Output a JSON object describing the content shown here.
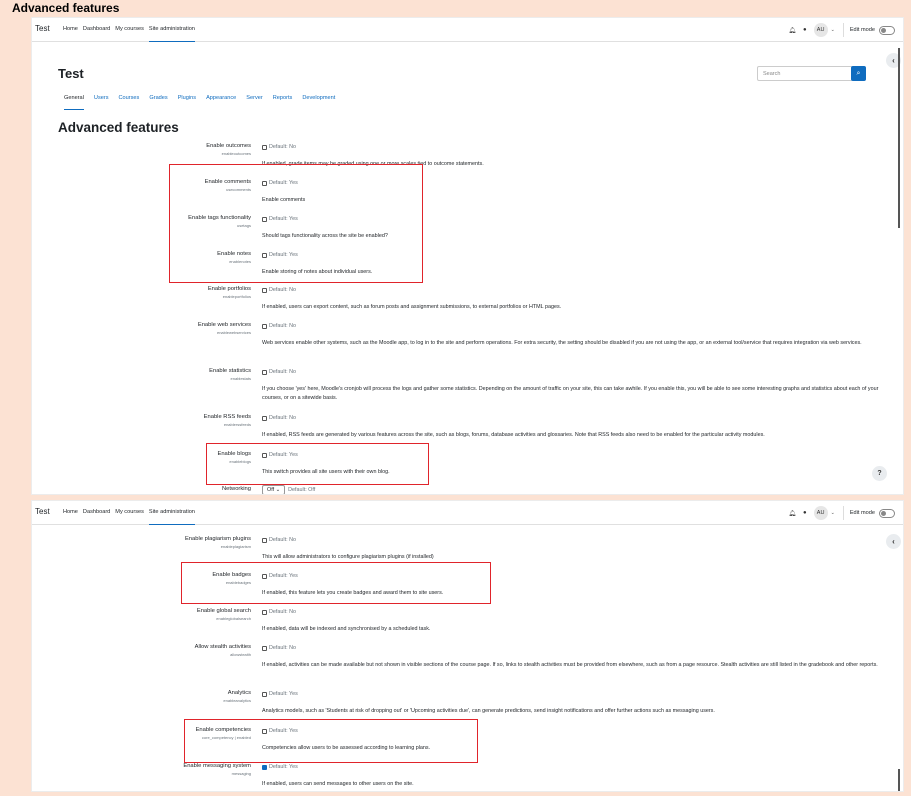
{
  "caption": "Advanced features",
  "navbar": {
    "brand": "Test",
    "links": [
      "Home",
      "Dashboard",
      "My courses",
      "Site administration"
    ],
    "avatar": "AU",
    "edit_mode": "Edit mode",
    "icons": [
      "bell-icon",
      "chat-icon"
    ]
  },
  "page": {
    "title": "Test",
    "search_placeholder": "Search",
    "tabs": [
      "General",
      "Users",
      "Courses",
      "Grades",
      "Plugins",
      "Appearance",
      "Server",
      "Reports",
      "Development"
    ],
    "section_title": "Advanced features",
    "help": "?",
    "drawer_toggle": "‹"
  },
  "panel1_settings": [
    {
      "label": "Enable outcomes",
      "key": "enableoutcomes",
      "default": "Default: No",
      "desc": "If enabled, grade items may be graded using one or more scales tied to outcome statements."
    },
    {
      "label": "Enable comments",
      "key": "usecomments",
      "default": "Default: Yes",
      "desc": "Enable comments"
    },
    {
      "label": "Enable tags functionality",
      "key": "usetags",
      "default": "Default: Yes",
      "desc": "Should tags functionality across the site be enabled?"
    },
    {
      "label": "Enable notes",
      "key": "enablenotes",
      "default": "Default: Yes",
      "desc": "Enable storing of notes about individual users."
    },
    {
      "label": "Enable portfolios",
      "key": "enableportfolios",
      "default": "Default: No",
      "desc": "If enabled, users can export content, such as forum posts and assignment submissions, to external portfolios or HTML pages."
    },
    {
      "label": "Enable web services",
      "key": "enablewebservices",
      "default": "Default: No",
      "desc": "Web services enable other systems, such as the Moodle app, to log in to the site and perform operations. For extra security, the setting should be disabled if you are not using the app, or an external tool/service that requires integration via web services."
    },
    {
      "label": "Enable statistics",
      "key": "enablestats",
      "default": "Default: No",
      "desc": "If you choose 'yes' here, Moodle's cronjob will process the logs and gather some statistics. Depending on the amount of traffic on your site, this can take awhile. If you enable this, you will be able to see some interesting graphs and statistics about each of your courses, or on a sitewide basis."
    },
    {
      "label": "Enable RSS feeds",
      "key": "enablerssfeeds",
      "default": "Default: No",
      "desc": "If enabled, RSS feeds are generated by various features across the site, such as blogs, forums, database activities and glossaries. Note that RSS feeds also need to be enabled for the particular activity modules."
    },
    {
      "label": "Enable blogs",
      "key": "enableblogs",
      "default": "Default: Yes",
      "desc": "This switch provides all site users with their own blog."
    }
  ],
  "networking": {
    "label": "Networking",
    "select_value": "Off",
    "default": "Default: Off"
  },
  "panel2_settings": [
    {
      "label": "Enable plagiarism plugins",
      "key": "enableplagiarism",
      "default": "Default: No",
      "checked": false,
      "desc": "This will allow administrators to configure plagiarism plugins (if installed)"
    },
    {
      "label": "Enable badges",
      "key": "enablebadges",
      "default": "Default: Yes",
      "checked": false,
      "desc": "If enabled, this feature lets you create badges and award them to site users."
    },
    {
      "label": "Enable global search",
      "key": "enableglobalsearch",
      "default": "Default: No",
      "checked": false,
      "desc": "If enabled, data will be indexed and synchronised by a scheduled task."
    },
    {
      "label": "Allow stealth activities",
      "key": "allowstealth",
      "default": "Default: No",
      "checked": false,
      "desc": "If enabled, activities can be made available but not shown in visible sections of the course page. If so, links to stealth activities must be provided from elsewhere, such as from a page resource. Stealth activities are still listed in the gradebook and other reports."
    },
    {
      "label": "Analytics",
      "key": "enableanalytics",
      "default": "Default: Yes",
      "checked": false,
      "desc": "Analytics models, such as 'Students at risk of dropping out' or 'Upcoming activities due', can generate predictions, send insight notifications and offer further actions such as messaging users."
    },
    {
      "label": "Enable competencies",
      "key": "core_competency | enabled",
      "default": "Default: Yes",
      "checked": false,
      "desc": "Competencies allow users to be assessed according to learning plans."
    },
    {
      "label": "Enable messaging system",
      "key": "messaging",
      "default": "Default: Yes",
      "checked": true,
      "desc": "If enabled, users can send messages to other users on the site."
    }
  ],
  "colors": {
    "accent": "#0f6cbf",
    "highlight": "#e0242b",
    "background": "#fce2d3"
  }
}
